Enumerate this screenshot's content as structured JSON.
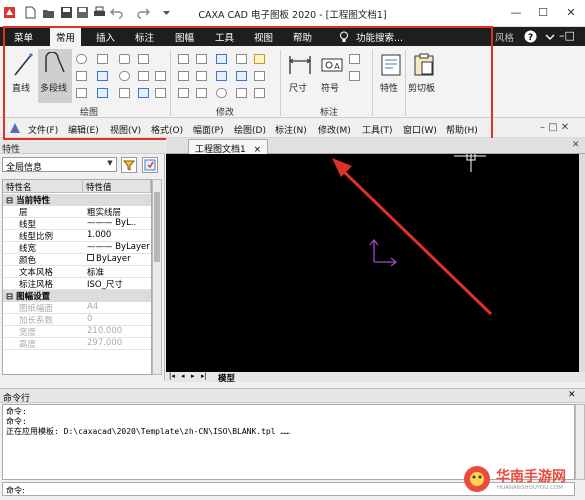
{
  "window": {
    "title": "CAXA CAD 电子图板 2020 - [工程图文档1]",
    "controls": [
      "—",
      "☐",
      "✕"
    ]
  },
  "ribbon": {
    "tabs": [
      {
        "label": "菜单",
        "active": false
      },
      {
        "label": "常用",
        "active": true
      },
      {
        "label": "插入",
        "active": false
      },
      {
        "label": "标注",
        "active": false
      },
      {
        "label": "图幅",
        "active": false
      },
      {
        "label": "工具",
        "active": false
      },
      {
        "label": "视图",
        "active": false
      },
      {
        "label": "帮助",
        "active": false
      }
    ],
    "search_label": "功能搜索...",
    "style_label": "风格",
    "groups": {
      "draw": "绘图",
      "modify": "修改",
      "annotate": "标注"
    },
    "buttons": {
      "line": "直线",
      "polyline": "多段线",
      "dimension": "尺寸",
      "symbol": "符号",
      "properties": "特性",
      "clipboard": "剪切板"
    }
  },
  "menubar": {
    "items": [
      "文件(F)",
      "编辑(E)",
      "视图(V)",
      "格式(O)",
      "幅面(P)",
      "绘图(D)",
      "标注(N)",
      "修改(M)",
      "工具(T)",
      "窗口(W)",
      "帮助(H)"
    ]
  },
  "properties": {
    "title": "特性",
    "selector": "全局信息",
    "columns": [
      "特性名",
      "特性值"
    ],
    "categories": [
      {
        "name": "当前特性",
        "rows": [
          {
            "name": "层",
            "value": "粗实线层"
          },
          {
            "name": "线型",
            "value": "——— ByL.."
          },
          {
            "name": "线型比例",
            "value": "1.000"
          },
          {
            "name": "线宽",
            "value": "——— ByLayer"
          },
          {
            "name": "颜色",
            "value": "ByLayer"
          },
          {
            "name": "文本风格",
            "value": "标准"
          },
          {
            "name": "标注风格",
            "value": "ISO_尺寸"
          }
        ]
      },
      {
        "name": "图幅设置",
        "rows": [
          {
            "name": "图纸幅面",
            "value": "A4"
          },
          {
            "name": "加长系数",
            "value": "0"
          },
          {
            "name": "宽度",
            "value": "210.000"
          },
          {
            "name": "高度",
            "value": "297.000"
          }
        ]
      }
    ]
  },
  "document": {
    "tab_label": "工程图文档1",
    "close": "×",
    "layout_nav": [
      "|◂",
      "◂",
      "▸",
      "▸|"
    ],
    "model_tab": "模型"
  },
  "command": {
    "title": "命令行",
    "lines": [
      "命令:",
      "命令:",
      "正在应用模板: D:\\caxacad\\2020\\Template\\zh-CN\\ISO\\BLANK.tpl ……"
    ],
    "input_prefix": "命令:"
  },
  "watermark": {
    "title": "华南手游网",
    "url": "HUANANSHOUYOU.COM"
  },
  "colors": {
    "annotation": "#e0302a",
    "canvas": "#000000",
    "ucs": "#9b4bc9",
    "cursor": "#ffffff"
  }
}
